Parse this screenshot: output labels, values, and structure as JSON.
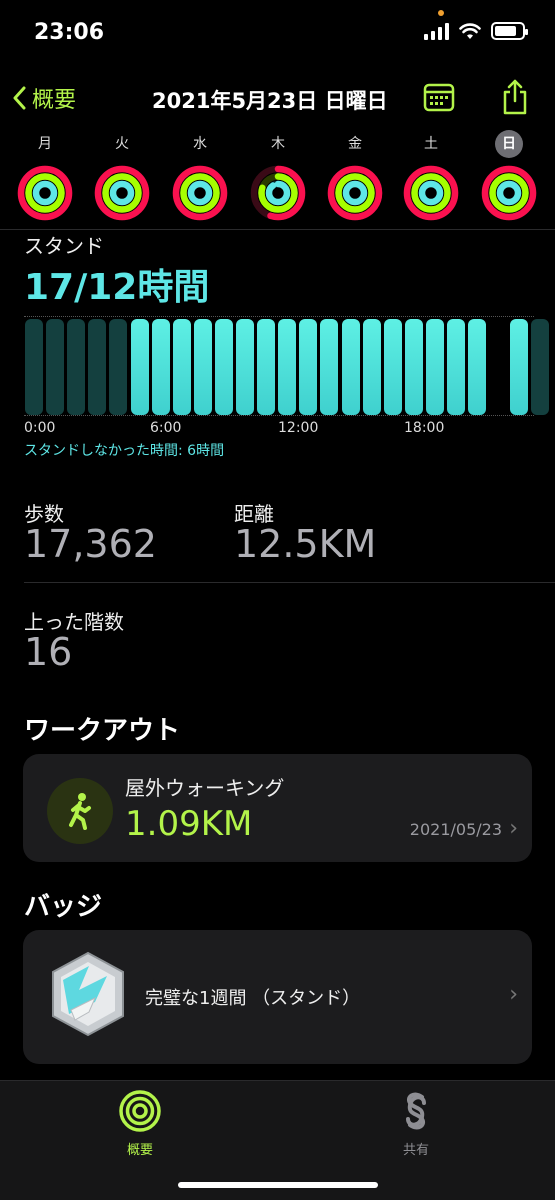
{
  "status": {
    "time": "23:06"
  },
  "nav": {
    "back_label": "概要",
    "title": "2021年5月23日 日曜日"
  },
  "week": [
    {
      "label": "月",
      "selected": false
    },
    {
      "label": "火",
      "selected": false
    },
    {
      "label": "水",
      "selected": false
    },
    {
      "label": "木",
      "selected": false
    },
    {
      "label": "金",
      "selected": false
    },
    {
      "label": "土",
      "selected": false
    },
    {
      "label": "日",
      "selected": true
    }
  ],
  "stand": {
    "label": "スタンド",
    "value": "17/12時間",
    "hours": [
      0,
      0,
      0,
      0,
      0,
      1,
      1,
      1,
      1,
      1,
      1,
      1,
      1,
      1,
      1,
      1,
      1,
      1,
      1,
      1,
      1,
      1,
      null,
      1,
      0
    ],
    "ticks": [
      "0:00",
      "6:00",
      "12:00",
      "18:00"
    ],
    "note": "スタンドしなかった時間: 6時間"
  },
  "metrics": {
    "steps_label": "歩数",
    "steps_value": "17,362",
    "distance_label": "距離",
    "distance_value": "12.5KM",
    "floors_label": "上った階数",
    "floors_value": "16"
  },
  "workout": {
    "section": "ワークアウト",
    "name": "屋外ウォーキング",
    "distance": "1.09KM",
    "date": "2021/05/23"
  },
  "badges": {
    "section": "バッジ",
    "name": "完璧な1週間 （スタンド）"
  },
  "tabs": [
    {
      "label": "概要",
      "active": true
    },
    {
      "label": "共有",
      "active": false
    }
  ],
  "colors": {
    "accent": "#b3f34a",
    "stand": "#5ee6e6",
    "move": "#fa114f",
    "exercise": "#a6ff00"
  }
}
